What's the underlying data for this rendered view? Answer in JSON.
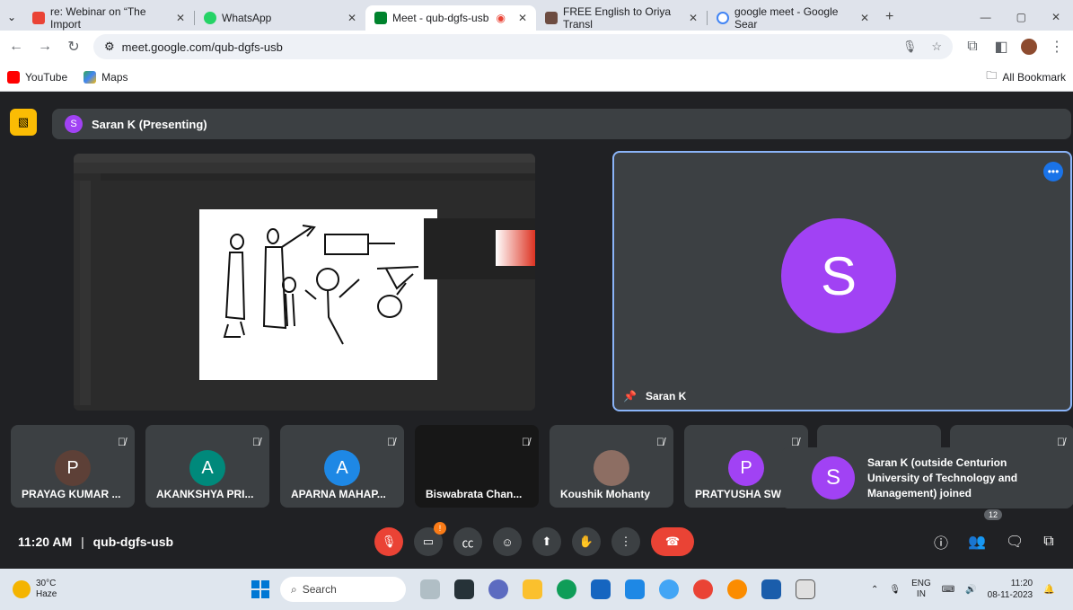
{
  "browser": {
    "tabs": [
      {
        "title": "re: Webinar on “The Import",
        "active": false
      },
      {
        "title": "WhatsApp",
        "active": false
      },
      {
        "title": "Meet - qub-dgfs-usb",
        "active": true
      },
      {
        "title": "FREE English to Oriya Transl",
        "active": false
      },
      {
        "title": "google meet - Google Sear",
        "active": false
      }
    ],
    "url": "meet.google.com/qub-dgfs-usb",
    "bookmarks": [
      "YouTube",
      "Maps"
    ],
    "all_bookmarks": "All Bookmark"
  },
  "meet": {
    "presenter_banner": "Saran K (Presenting)",
    "presenter_initial": "S",
    "speaker_name": "Saran K",
    "speaker_initial": "S",
    "participants": [
      {
        "initial": "P",
        "name": "PRAYAG KUMAR ...",
        "color": "#5d4037"
      },
      {
        "initial": "A",
        "name": "AKANKSHYA PRI...",
        "color": "#00897b"
      },
      {
        "initial": "A",
        "name": "APARNA MAHAP...",
        "color": "#1e88e5"
      },
      {
        "initial": "",
        "name": "Biswabrata Chan...",
        "color": "#202124"
      },
      {
        "initial": "",
        "name": "Koushik Mohanty",
        "color": "#8d6e63"
      },
      {
        "initial": "P",
        "name": "PRATYUSHA SW...",
        "color": "#a142f4"
      }
    ],
    "toast": {
      "initial": "S",
      "text": "Saran K (outside Centurion University of Technology and Management) joined"
    },
    "time": "11:20 AM",
    "separator": "|",
    "meeting_code": "qub-dgfs-usb",
    "people_count": "12",
    "camera_badge": "!"
  },
  "taskbar": {
    "temp": "30°C",
    "weather": "Haze",
    "search": "Search",
    "lang": "ENG",
    "region": "IN",
    "time": "11:20",
    "date": "08-11-2023"
  }
}
